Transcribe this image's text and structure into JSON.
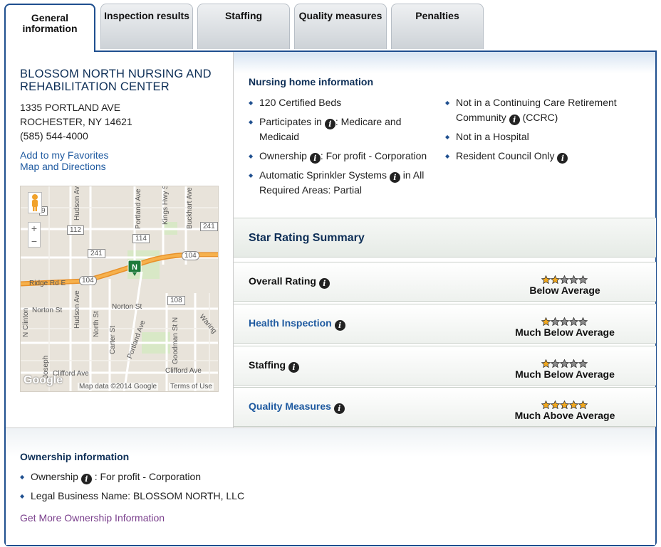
{
  "tabs": [
    {
      "label": "General information",
      "active": true
    },
    {
      "label": "Inspection results",
      "active": false
    },
    {
      "label": "Staffing",
      "active": false
    },
    {
      "label": "Quality measures",
      "active": false
    },
    {
      "label": "Penalties",
      "active": false
    }
  ],
  "facility": {
    "name": "BLOSSOM NORTH NURSING AND REHABILITATION CENTER",
    "address_line1": "1335 PORTLAND AVE",
    "address_line2": "ROCHESTER, NY 14621",
    "phone": "(585) 544-4000",
    "favorites_link": "Add to my Favorites",
    "directions_link": "Map and Directions"
  },
  "map": {
    "marker_letter": "N",
    "attribution": "Map data ©2014 Google",
    "terms": "Terms of Use",
    "logo": "Google",
    "street_labels": [
      "Hudson Ave",
      "Portland Ave",
      "Kings Hwy S",
      "Buckhart Ave",
      "Ridge Rd E",
      "Norton St",
      "Norton St",
      "North St",
      "Carter St",
      "Portland Ave",
      "Goodman St N",
      "Waring",
      "Clifford Ave",
      "Clifford Ave",
      "Joseph",
      "Hudson Ave",
      "N Clinton"
    ],
    "route_shields": [
      "112",
      "114",
      "241",
      "241",
      "104",
      "104",
      "108",
      "9"
    ]
  },
  "nursing_home_info": {
    "title": "Nursing home information",
    "left_items": [
      {
        "pre": "120 Certified Beds",
        "info": false,
        "post": ""
      },
      {
        "pre": "Participates in",
        "info": true,
        "post": ": Medicare and Medicaid"
      },
      {
        "pre": "Ownership",
        "info": true,
        "post": ": For profit - Corporation"
      },
      {
        "pre": "Automatic Sprinkler Systems",
        "info": true,
        "post": " in All Required Areas: Partial"
      }
    ],
    "right_items": [
      {
        "pre": "Not in a Continuing Care Retirement Community",
        "info": true,
        "post": " (CCRC)"
      },
      {
        "pre": "Not in a Hospital",
        "info": false,
        "post": ""
      },
      {
        "pre": "Resident Council Only",
        "info": true,
        "post": ""
      }
    ]
  },
  "star_rating": {
    "title": "Star Rating Summary",
    "rows": [
      {
        "label": "Overall Rating",
        "link": false,
        "stars": 2,
        "max": 5,
        "description": "Below Average"
      },
      {
        "label": "Health Inspection",
        "link": true,
        "stars": 1,
        "max": 5,
        "description": "Much Below Average"
      },
      {
        "label": "Staffing",
        "link": false,
        "stars": 1,
        "max": 5,
        "description": "Much Below Average"
      },
      {
        "label": "Quality Measures",
        "link": true,
        "stars": 5,
        "max": 5,
        "description": "Much Above Average"
      }
    ]
  },
  "ownership": {
    "title": "Ownership information",
    "ownership_label": "Ownership",
    "ownership_value": ": For profit - Corporation",
    "legal_name": "Legal Business Name: BLOSSOM NORTH, LLC",
    "more_link": "Get More Ownership Information"
  },
  "colors": {
    "brand_blue": "#1f4f8f",
    "star_filled": "#f2a81d",
    "star_empty": "#8a8a8a",
    "highway": "#f0a030"
  }
}
